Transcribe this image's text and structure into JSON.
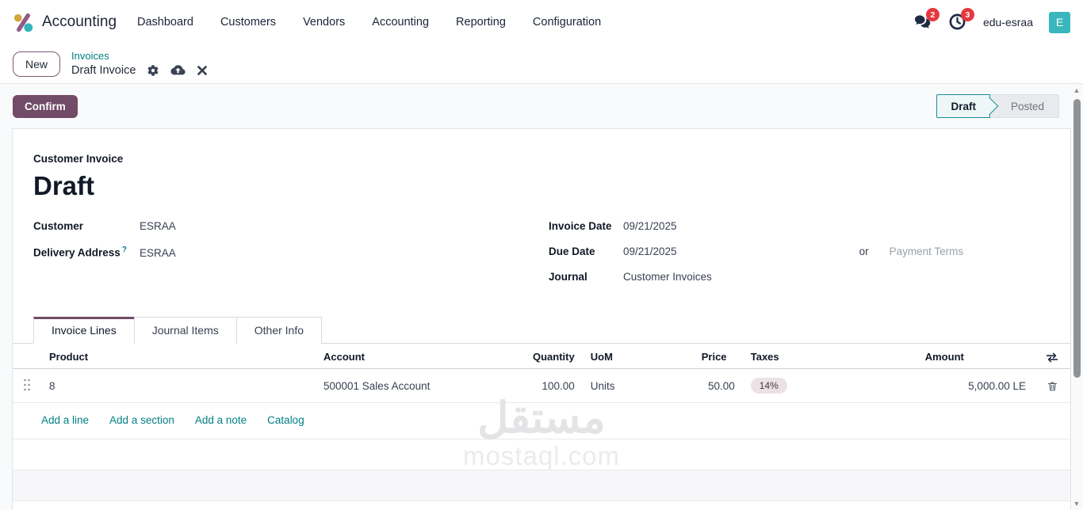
{
  "nav": {
    "app_name": "Accounting",
    "menu_items": [
      "Dashboard",
      "Customers",
      "Vendors",
      "Accounting",
      "Reporting",
      "Configuration"
    ],
    "messages_badge": "2",
    "activities_badge": "3",
    "user_name": "edu-esraa",
    "avatar_initial": "E"
  },
  "breadcrumb": {
    "new_button": "New",
    "parent": "Invoices",
    "current": "Draft Invoice"
  },
  "actions": {
    "confirm_label": "Confirm",
    "statusbar": [
      {
        "label": "Draft",
        "active": true
      },
      {
        "label": "Posted",
        "active": false
      }
    ]
  },
  "invoice": {
    "type_label": "Customer Invoice",
    "title": "Draft",
    "customer_label": "Customer",
    "customer_value": "ESRAA",
    "delivery_label": "Delivery Address",
    "delivery_hint": "?",
    "delivery_value": "ESRAA",
    "invoice_date_label": "Invoice Date",
    "invoice_date_value": "09/21/2025",
    "due_date_label": "Due Date",
    "due_date_value": "09/21/2025",
    "or_label": "or",
    "payment_terms_placeholder": "Payment Terms",
    "journal_label": "Journal",
    "journal_value": "Customer Invoices"
  },
  "tabs": [
    {
      "label": "Invoice Lines"
    },
    {
      "label": "Journal Items"
    },
    {
      "label": "Other Info"
    }
  ],
  "lines_table": {
    "headers": {
      "product": "Product",
      "account": "Account",
      "quantity": "Quantity",
      "uom": "UoM",
      "price": "Price",
      "taxes": "Taxes",
      "amount": "Amount"
    },
    "rows": [
      {
        "product": "8",
        "account": "500001 Sales Account",
        "quantity": "100.00",
        "uom": "Units",
        "price": "50.00",
        "tax": "14%",
        "amount": "5,000.00 LE"
      }
    ],
    "footer_links": [
      "Add a line",
      "Add a section",
      "Add a note",
      "Catalog"
    ]
  },
  "watermark": {
    "arabic": "مستقل",
    "latin": "mostaql.com"
  },
  "colors": {
    "accent_purple": "#714B67",
    "link_teal": "#017E84",
    "badge_red": "#E4383F",
    "avatar_teal": "#3AB7BC",
    "status_draft_bg": "#EEF7F8",
    "status_draft_border": "#1D8E94",
    "tax_pill_bg": "#ECE1E4"
  }
}
